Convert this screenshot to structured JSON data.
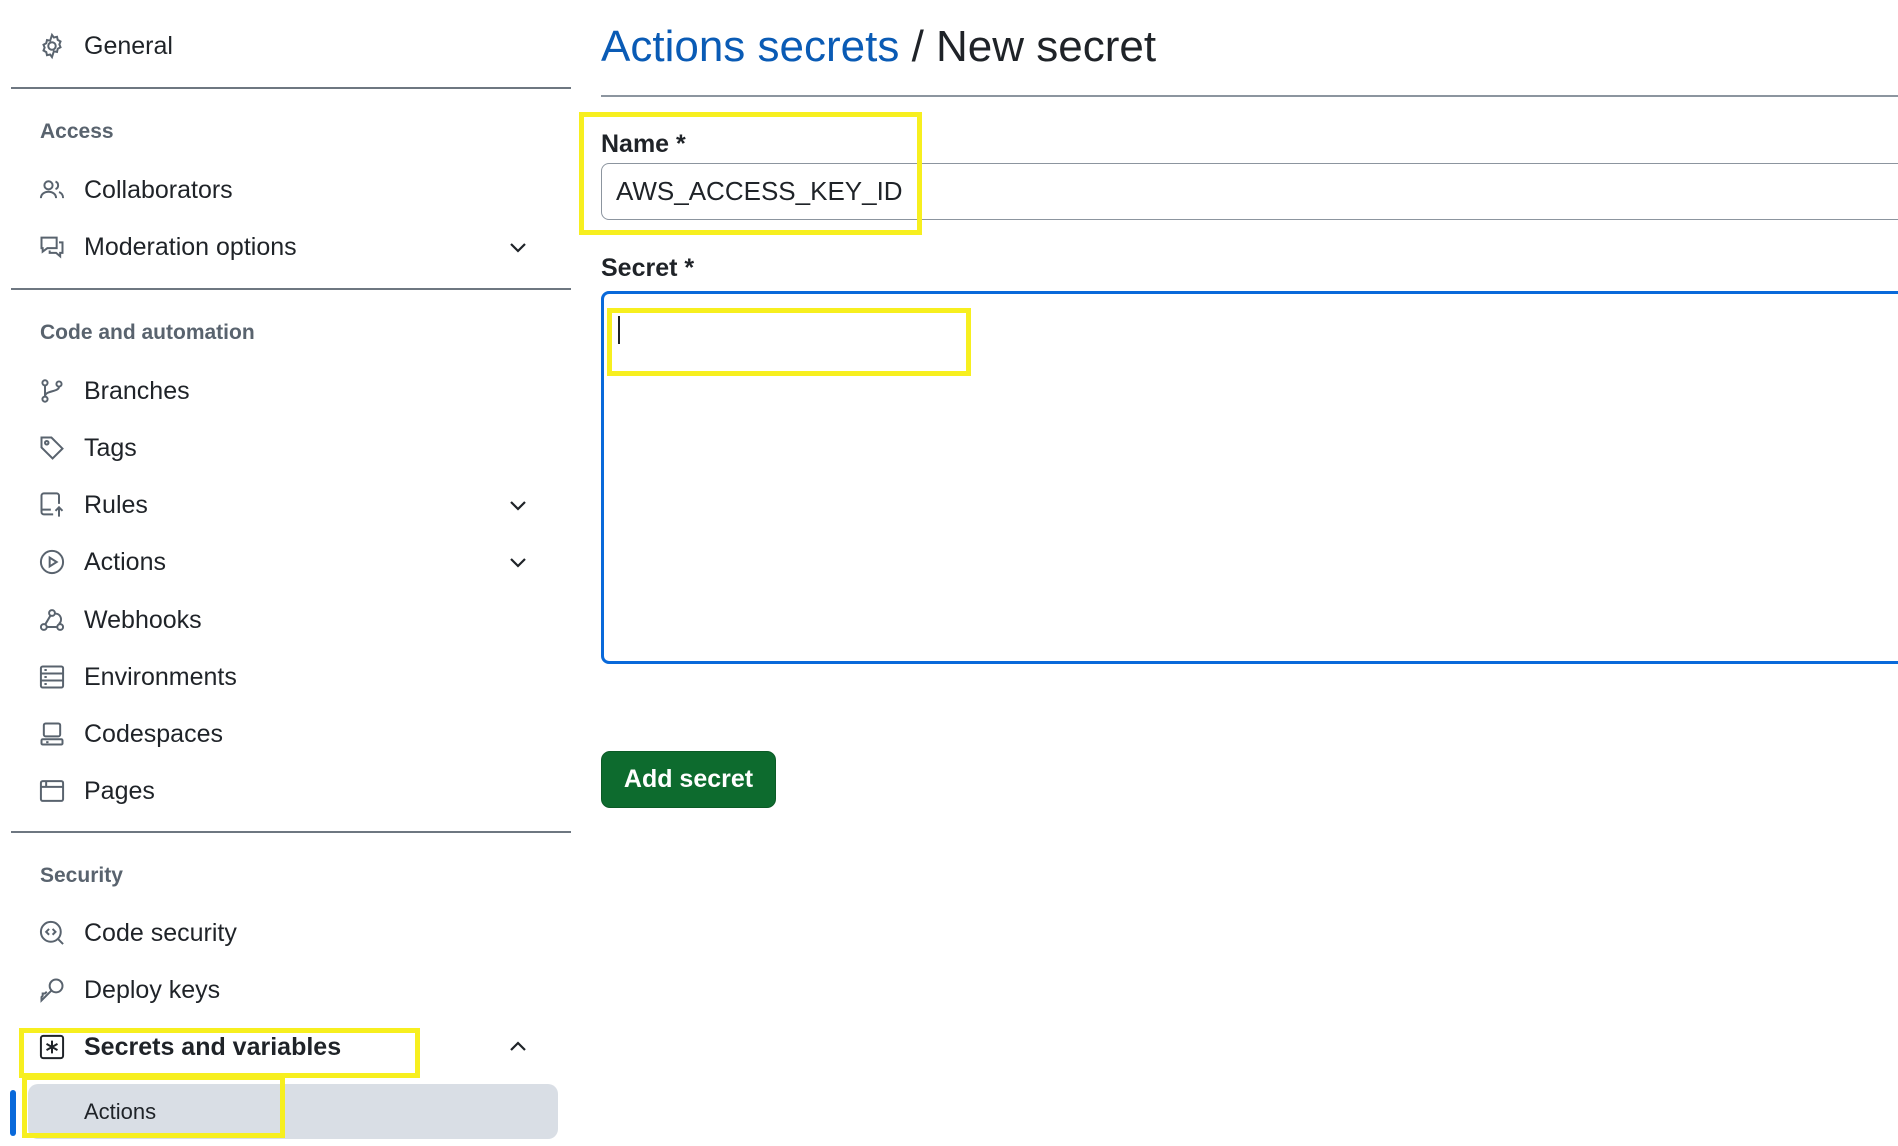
{
  "sidebar": {
    "general": "General",
    "access_label": "Access",
    "collaborators": "Collaborators",
    "moderation": "Moderation options",
    "code_label": "Code and automation",
    "branches": "Branches",
    "tags": "Tags",
    "rules": "Rules",
    "actions": "Actions",
    "webhooks": "Webhooks",
    "environments": "Environments",
    "codespaces": "Codespaces",
    "pages": "Pages",
    "security_label": "Security",
    "code_security": "Code security",
    "deploy_keys": "Deploy keys",
    "secrets_variables": "Secrets and variables",
    "secrets_actions": "Actions"
  },
  "main": {
    "breadcrumb_link": "Actions secrets",
    "breadcrumb_sep": " / ",
    "breadcrumb_current": "New secret",
    "name_label": "Name *",
    "name_value": "AWS_ACCESS_KEY_ID",
    "secret_label": "Secret *",
    "secret_value": "",
    "add_button": "Add secret"
  },
  "colors": {
    "link": "#0a5bb5",
    "focus": "#0969da",
    "button": "#0d6b2e",
    "highlight": "#f7ef1f",
    "active_bg": "#d9dee5"
  }
}
